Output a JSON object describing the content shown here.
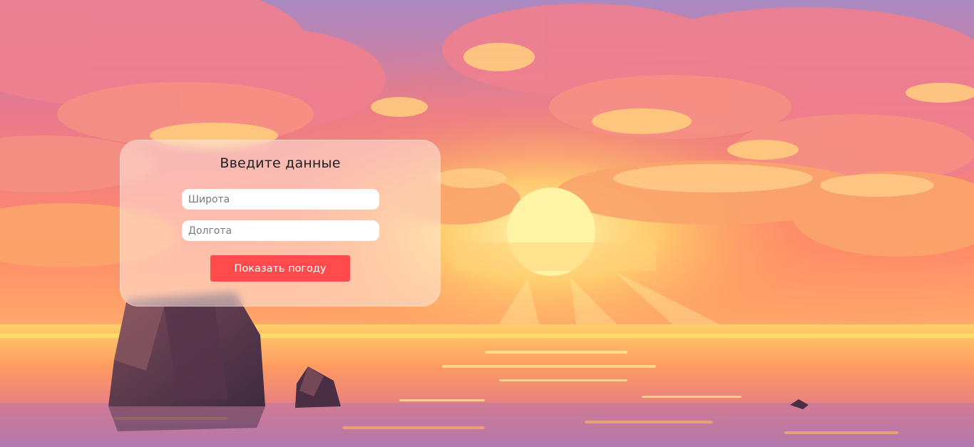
{
  "form": {
    "title": "Введите данные",
    "latitude_placeholder": "Широта",
    "latitude_value": "",
    "longitude_placeholder": "Долгота",
    "longitude_value": "",
    "submit_label": "Показать погоду"
  },
  "colors": {
    "accent_button": "#ff4b4b",
    "card_background": "rgba(255, 238, 228, 0.52)",
    "input_background": "#ffffff"
  }
}
